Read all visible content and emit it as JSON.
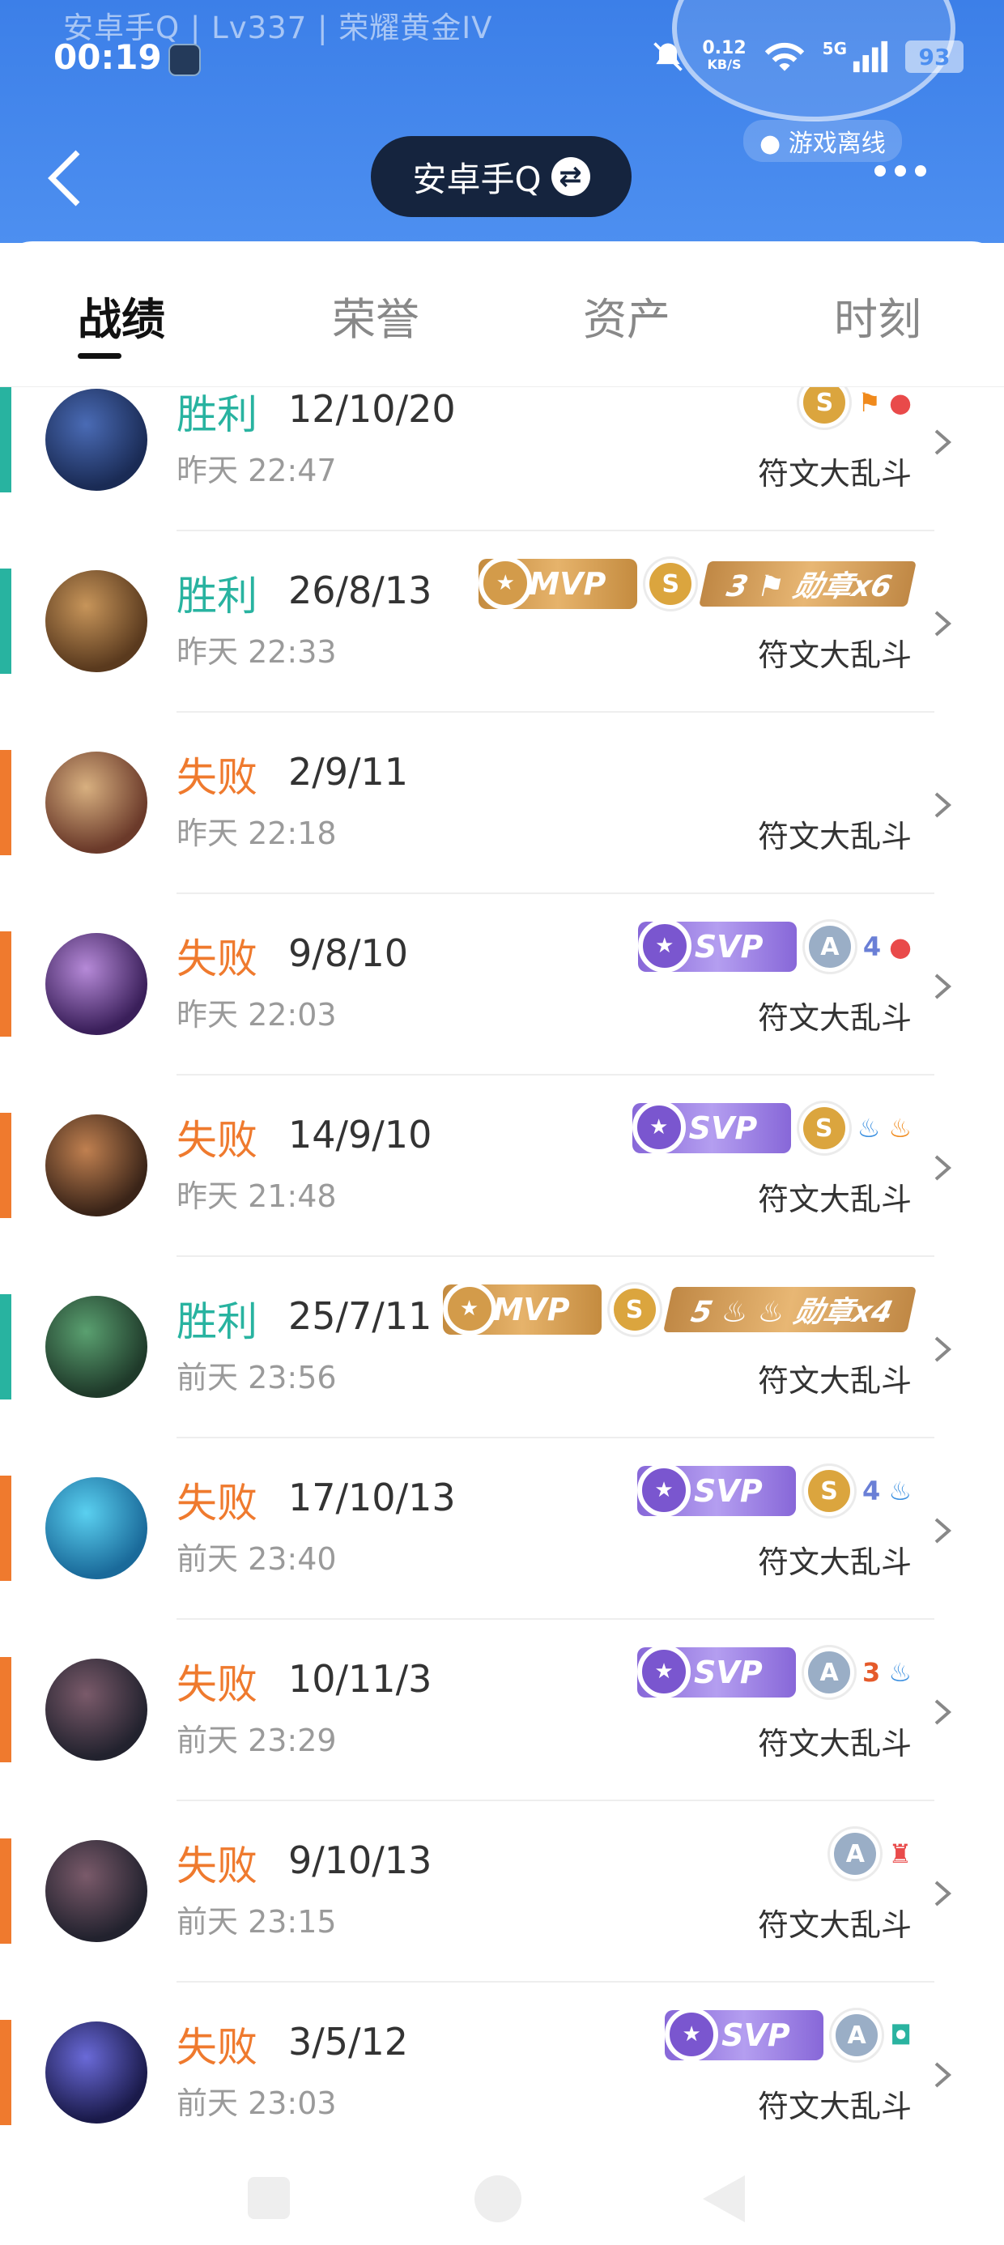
{
  "status_bar": {
    "game_info": "安卓手Q | Lv337 | 荣耀黄金IV",
    "time": "00:19",
    "net_speed": "0.12",
    "net_unit": "KB/S",
    "signal": "5G",
    "battery": "93"
  },
  "header": {
    "offline_label": "游戏离线",
    "account_name": "安卓手Q",
    "accent_color": "#4d8ff0"
  },
  "tabs": [
    {
      "label": "战绩",
      "active": true
    },
    {
      "label": "荣誉",
      "active": false
    },
    {
      "label": "资产",
      "active": false
    },
    {
      "label": "时刻",
      "active": false
    }
  ],
  "colors": {
    "win": "#28b3a0",
    "loss": "#ef7a2e"
  },
  "matches": [
    {
      "result": "胜利",
      "outcome": "win",
      "kda": "12/10/20",
      "time": "昨天 22:47",
      "mode": "符文大乱斗",
      "badges": [
        {
          "type": "coin",
          "grade": "S"
        },
        {
          "type": "mini",
          "text": "⚑",
          "color": "#f08a1c"
        },
        {
          "type": "mini",
          "text": "●",
          "color": "#e94a4a"
        }
      ],
      "avatar": [
        "#1a2b55",
        "#4a6bb5"
      ]
    },
    {
      "result": "胜利",
      "outcome": "win",
      "kda": "26/8/13",
      "time": "昨天 22:33",
      "mode": "符文大乱斗",
      "badges": [
        {
          "type": "mvp",
          "text": "MVP"
        },
        {
          "type": "coin",
          "grade": "S"
        },
        {
          "type": "medal",
          "text": "3 ⚑ 勋章x6"
        }
      ],
      "avatar": [
        "#5a3a1e",
        "#c7955a"
      ]
    },
    {
      "result": "失败",
      "outcome": "loss",
      "kda": "2/9/11",
      "time": "昨天 22:18",
      "mode": "符文大乱斗",
      "badges": [],
      "avatar": [
        "#6b3a2a",
        "#d8b080"
      ]
    },
    {
      "result": "失败",
      "outcome": "loss",
      "kda": "9/8/10",
      "time": "昨天 22:03",
      "mode": "符文大乱斗",
      "badges": [
        {
          "type": "svp",
          "text": "SVP"
        },
        {
          "type": "coin",
          "grade": "A"
        },
        {
          "type": "mini",
          "text": "4",
          "color": "#6a7fd6"
        },
        {
          "type": "mini",
          "text": "●",
          "color": "#e94a4a"
        }
      ],
      "avatar": [
        "#3a1f5a",
        "#b68ad8"
      ]
    },
    {
      "result": "失败",
      "outcome": "loss",
      "kda": "14/9/10",
      "time": "昨天 21:48",
      "mode": "符文大乱斗",
      "badges": [
        {
          "type": "svp",
          "text": "SVP"
        },
        {
          "type": "coin",
          "grade": "S"
        },
        {
          "type": "mini",
          "text": "♨",
          "color": "#3a8fe0"
        },
        {
          "type": "mini",
          "text": "♨",
          "color": "#f08a1c"
        }
      ],
      "avatar": [
        "#3a2418",
        "#c08050"
      ]
    },
    {
      "result": "胜利",
      "outcome": "win",
      "kda": "25/7/11",
      "time": "前天 23:56",
      "mode": "符文大乱斗",
      "badges": [
        {
          "type": "mvp",
          "text": "MVP"
        },
        {
          "type": "coin",
          "grade": "S"
        },
        {
          "type": "medal",
          "text": "5 ♨ ♨ 勋章x4"
        }
      ],
      "avatar": [
        "#1f3a2a",
        "#5aa070"
      ]
    },
    {
      "result": "失败",
      "outcome": "loss",
      "kda": "17/10/13",
      "time": "前天 23:40",
      "mode": "符文大乱斗",
      "badges": [
        {
          "type": "svp",
          "text": "SVP"
        },
        {
          "type": "coin",
          "grade": "S"
        },
        {
          "type": "mini",
          "text": "4",
          "color": "#6a7fd6"
        },
        {
          "type": "mini",
          "text": "♨",
          "color": "#3a8fe0"
        }
      ],
      "avatar": [
        "#1a6a9a",
        "#5ad0f0"
      ]
    },
    {
      "result": "失败",
      "outcome": "loss",
      "kda": "10/11/3",
      "time": "前天 23:29",
      "mode": "符文大乱斗",
      "badges": [
        {
          "type": "svp",
          "text": "SVP"
        },
        {
          "type": "coin",
          "grade": "A"
        },
        {
          "type": "mini",
          "text": "3",
          "color": "#e55a2a"
        },
        {
          "type": "mini",
          "text": "♨",
          "color": "#3a8fe0"
        }
      ],
      "avatar": [
        "#22222e",
        "#7a5a6a"
      ]
    },
    {
      "result": "失败",
      "outcome": "loss",
      "kda": "9/10/13",
      "time": "前天 23:15",
      "mode": "符文大乱斗",
      "badges": [
        {
          "type": "coin",
          "grade": "A"
        },
        {
          "type": "mini",
          "text": "♜",
          "color": "#e94a4a"
        }
      ],
      "avatar": [
        "#22222e",
        "#7a5a6a"
      ]
    },
    {
      "result": "失败",
      "outcome": "loss",
      "kda": "3/5/12",
      "time": "前天 23:03",
      "mode": "符文大乱斗",
      "badges": [
        {
          "type": "svp",
          "text": "SVP"
        },
        {
          "type": "coin",
          "grade": "A"
        },
        {
          "type": "mini",
          "text": "◘",
          "color": "#2ab3a0"
        }
      ],
      "avatar": [
        "#1a1a4a",
        "#6a6ad8"
      ]
    }
  ]
}
